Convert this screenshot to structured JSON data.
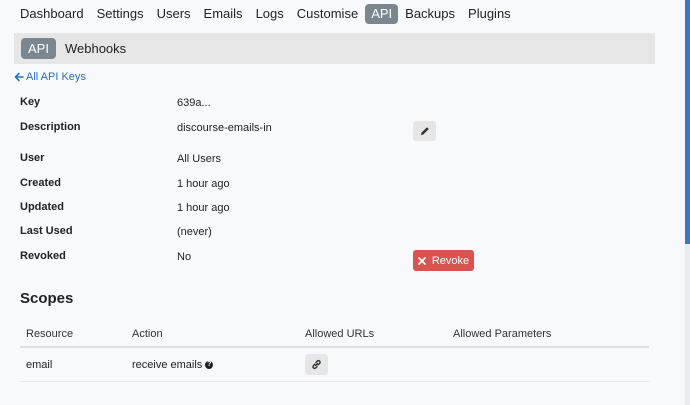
{
  "nav": {
    "items": [
      "Dashboard",
      "Settings",
      "Users",
      "Emails",
      "Logs",
      "Customise",
      "API",
      "Backups",
      "Plugins"
    ],
    "active_index": 6
  },
  "subnav": {
    "active": "API",
    "other": "Webhooks"
  },
  "back_link": "All API Keys",
  "details": {
    "key_label": "Key",
    "key_value": "639a...",
    "description_label": "Description",
    "description_value": "discourse-emails-in",
    "user_label": "User",
    "user_value": "All Users",
    "created_label": "Created",
    "created_value": "1 hour ago",
    "updated_label": "Updated",
    "updated_value": "1 hour ago",
    "last_used_label": "Last Used",
    "last_used_value": "(never)",
    "revoked_label": "Revoked",
    "revoked_value": "No"
  },
  "revoke_label": "Revoke",
  "scopes": {
    "title": "Scopes",
    "headers": [
      "Resource",
      "Action",
      "Allowed URLs",
      "Allowed Parameters"
    ],
    "rows": [
      {
        "resource": "email",
        "action": "receive emails"
      }
    ]
  },
  "icons": {
    "back": "arrow-left-icon",
    "edit": "pencil-icon",
    "revoke": "times-icon",
    "help": "question-circle-icon",
    "link": "link-icon"
  },
  "colors": {
    "accent": "#2a6fc4",
    "active_nav": "#7a8690",
    "danger": "#d9534f"
  }
}
